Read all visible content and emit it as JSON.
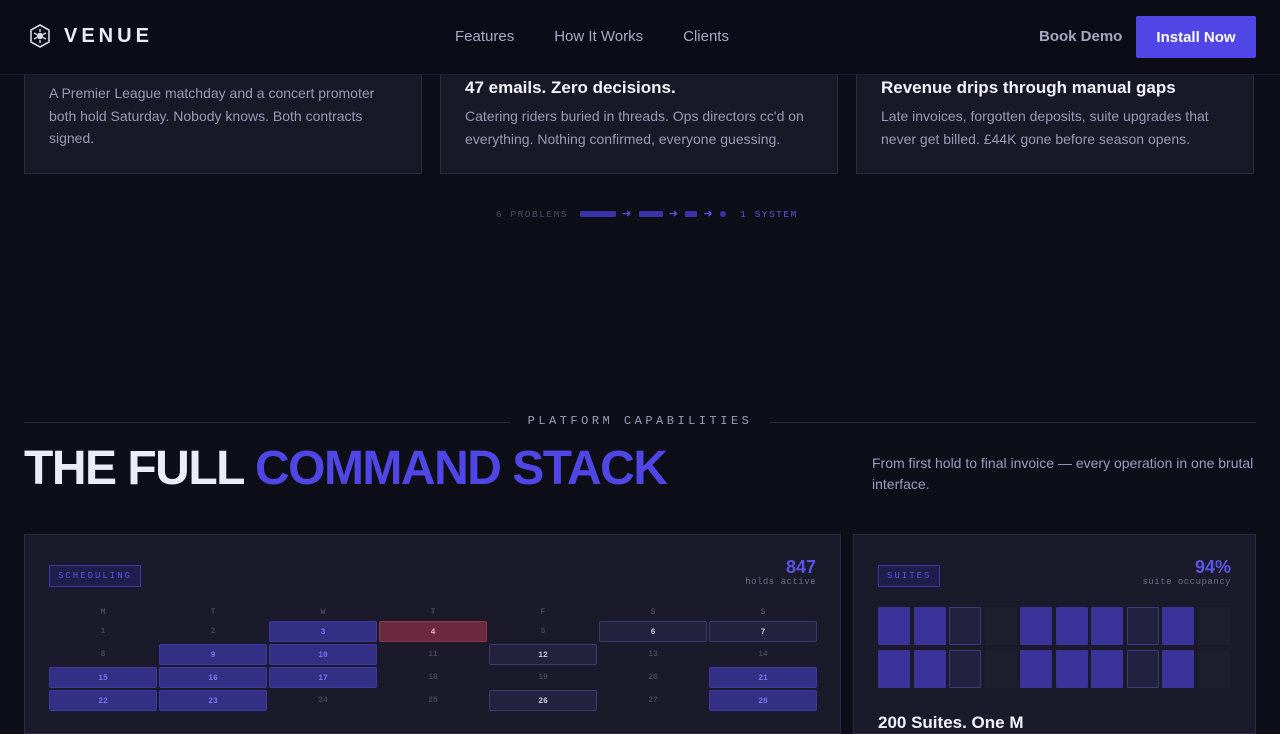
{
  "nav": {
    "logo_text": "VENUE",
    "links": [
      "Features",
      "How It Works",
      "Clients"
    ],
    "book_demo": "Book Demo",
    "install": "Install Now"
  },
  "problems": [
    {
      "title": "",
      "body": "A Premier League matchday and a concert promoter both hold Saturday. Nobody knows. Both contracts signed."
    },
    {
      "title": "47 emails. Zero decisions.",
      "body": "Catering riders buried in threads. Ops directors cc'd on everything. Nothing confirmed, everyone guessing."
    },
    {
      "title": "Revenue drips through manual gaps",
      "body": "Late invoices, forgotten deposits, suite upgrades that never get billed. £44K gone before season opens."
    }
  ],
  "progress": {
    "left_label": "6 PROBLEMS",
    "right_label": "1 SYSTEM"
  },
  "section": {
    "eyebrow": "PLATFORM CAPABILITIES",
    "headline_plain": "THE FULL ",
    "headline_accent": "COMMAND STACK",
    "subtext": "From first hold to final invoice — every operation in one brutal interface."
  },
  "scheduling": {
    "tag": "SCHEDULING",
    "stat_value": "847",
    "stat_caption": "holds active",
    "weekdays": [
      "M",
      "T",
      "W",
      "T",
      "F",
      "S",
      "S"
    ],
    "days": [
      {
        "n": "1",
        "s": "empty"
      },
      {
        "n": "2",
        "s": "empty"
      },
      {
        "n": "3",
        "s": "held"
      },
      {
        "n": "4",
        "s": "conflict"
      },
      {
        "n": "5",
        "s": "empty"
      },
      {
        "n": "6",
        "s": "outline"
      },
      {
        "n": "7",
        "s": "outline"
      },
      {
        "n": "8",
        "s": "empty"
      },
      {
        "n": "9",
        "s": "held"
      },
      {
        "n": "10",
        "s": "held"
      },
      {
        "n": "11",
        "s": "empty"
      },
      {
        "n": "12",
        "s": "outline"
      },
      {
        "n": "13",
        "s": "empty"
      },
      {
        "n": "14",
        "s": "empty"
      },
      {
        "n": "15",
        "s": "held"
      },
      {
        "n": "16",
        "s": "held"
      },
      {
        "n": "17",
        "s": "held"
      },
      {
        "n": "18",
        "s": "empty"
      },
      {
        "n": "19",
        "s": "empty"
      },
      {
        "n": "20",
        "s": "empty"
      },
      {
        "n": "21",
        "s": "held"
      },
      {
        "n": "22",
        "s": "held"
      },
      {
        "n": "23",
        "s": "held"
      },
      {
        "n": "24",
        "s": "empty"
      },
      {
        "n": "25",
        "s": "empty"
      },
      {
        "n": "26",
        "s": "outline"
      },
      {
        "n": "27",
        "s": "empty"
      },
      {
        "n": "28",
        "s": "held"
      }
    ]
  },
  "suites": {
    "tag": "SUITES",
    "stat_value": "94%",
    "stat_caption": "suite occupancy",
    "grid": [
      "booked",
      "booked",
      "outline",
      "empty",
      "booked",
      "booked",
      "booked",
      "outline",
      "booked",
      "empty",
      "booked",
      "booked",
      "outline",
      "empty",
      "booked",
      "booked",
      "booked",
      "outline",
      "booked",
      "empty"
    ],
    "title": "200 Suites. One M"
  }
}
